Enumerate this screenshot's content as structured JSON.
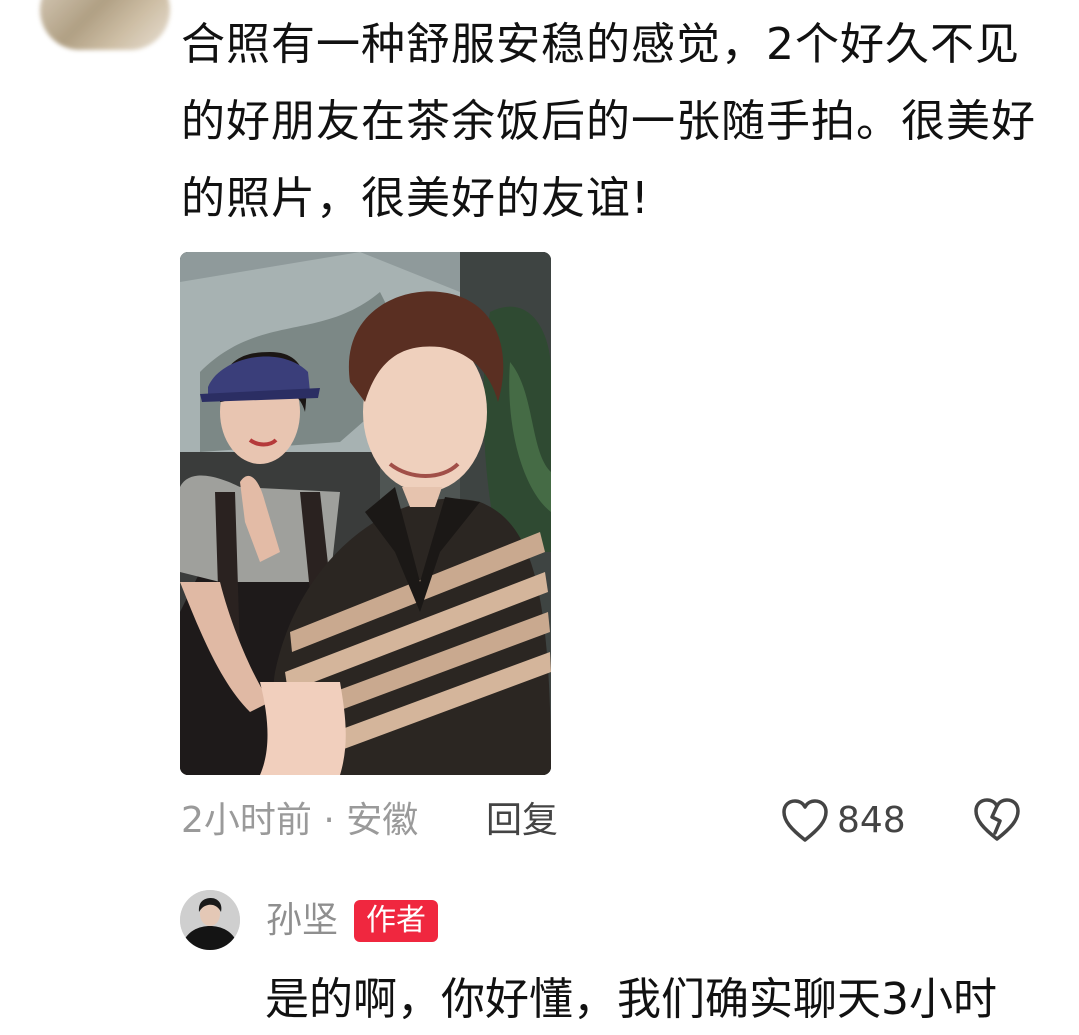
{
  "comment": {
    "text": "合照有一种舒服安稳的感觉，2个好久不见的好朋友在茶余饭后的一张随手拍。很美好的照片，很美好的友谊!",
    "time_location": "2小时前 · 安徽",
    "reply_label": "回复",
    "like_count": "848",
    "like_icon": "heart-outline-icon",
    "dislike_icon": "broken-heart-icon"
  },
  "reply": {
    "author": "孙坚",
    "badge": "作者",
    "text": "是的啊，你好懂，我们确实聊天3小时"
  },
  "colors": {
    "badge": "#f0273f",
    "meta_text": "#9a9a9a",
    "body_text": "#111111"
  }
}
